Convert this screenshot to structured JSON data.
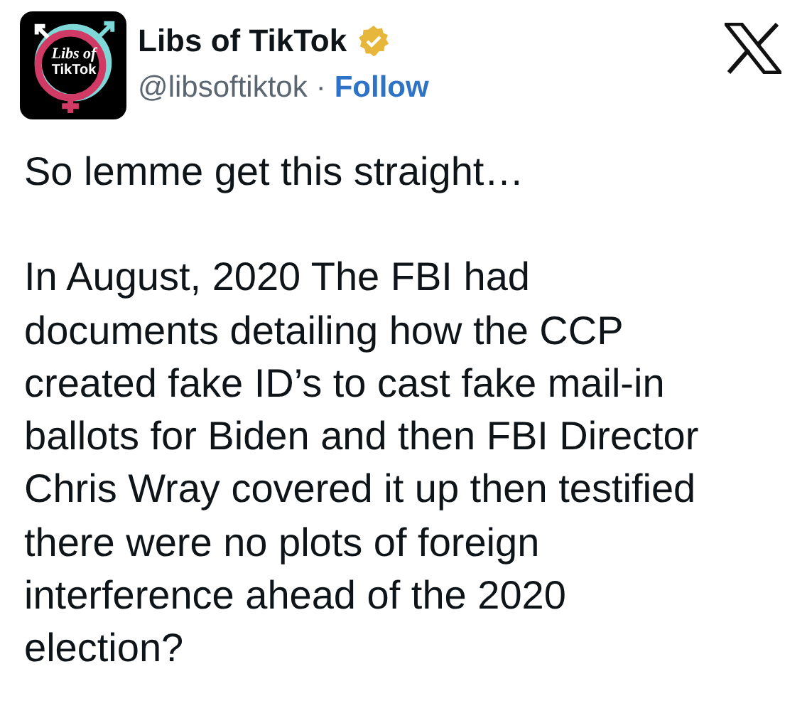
{
  "author": {
    "avatar": {
      "lines": [
        "Libs of",
        "TikTok"
      ]
    },
    "name": "Libs of TikTok",
    "verified": true,
    "handle": "@libsoftiktok",
    "separator": "·",
    "follow": "Follow"
  },
  "paragraphs": [
    "So lemme get this straight…",
    "In August, 2020 The FBI had\ndocuments detailing how the CCP\ncreated fake ID’s to cast fake mail-in\nballots for Biden and then FBI Director\nChris Wray covered it up then testified\nthere were no plots of foreign\ninterference ahead of the 2020\nelection?"
  ]
}
